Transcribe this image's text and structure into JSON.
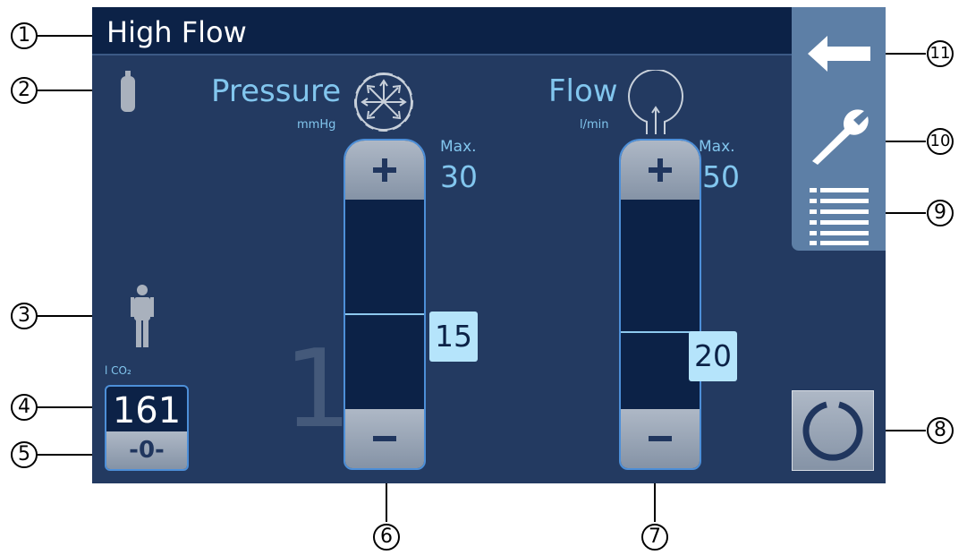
{
  "header": {
    "title": "High Flow"
  },
  "pressure": {
    "label": "Pressure",
    "unit": "mmHg",
    "max_label": "Max.",
    "max_value": "30",
    "value": "15",
    "icon": "radial-arrows-icon"
  },
  "flow": {
    "label": "Flow",
    "unit": "l/min",
    "max_label": "Max.",
    "max_value": "50",
    "value": "20",
    "icon": "flow-up-arrow-icon"
  },
  "stage_indicator": "1",
  "co2": {
    "label": "l CO₂",
    "value": "161",
    "reset_label": "-0-"
  },
  "side_panel": {
    "icons": [
      "back-arrow-icon",
      "wrench-icon",
      "menu-list-icon"
    ]
  },
  "callouts": [
    "1",
    "2",
    "3",
    "4",
    "5",
    "6",
    "7",
    "8",
    "9",
    "10",
    "11"
  ],
  "colors": {
    "screen_bg": "#233a61",
    "titlebar_bg": "#0c2247",
    "accent_text": "#82c6ee",
    "value_highlight": "#b5e4fb",
    "slider_border": "#4d8fd8",
    "button_gray": "#9aa5b5",
    "side_panel": "#5d7fa6"
  }
}
